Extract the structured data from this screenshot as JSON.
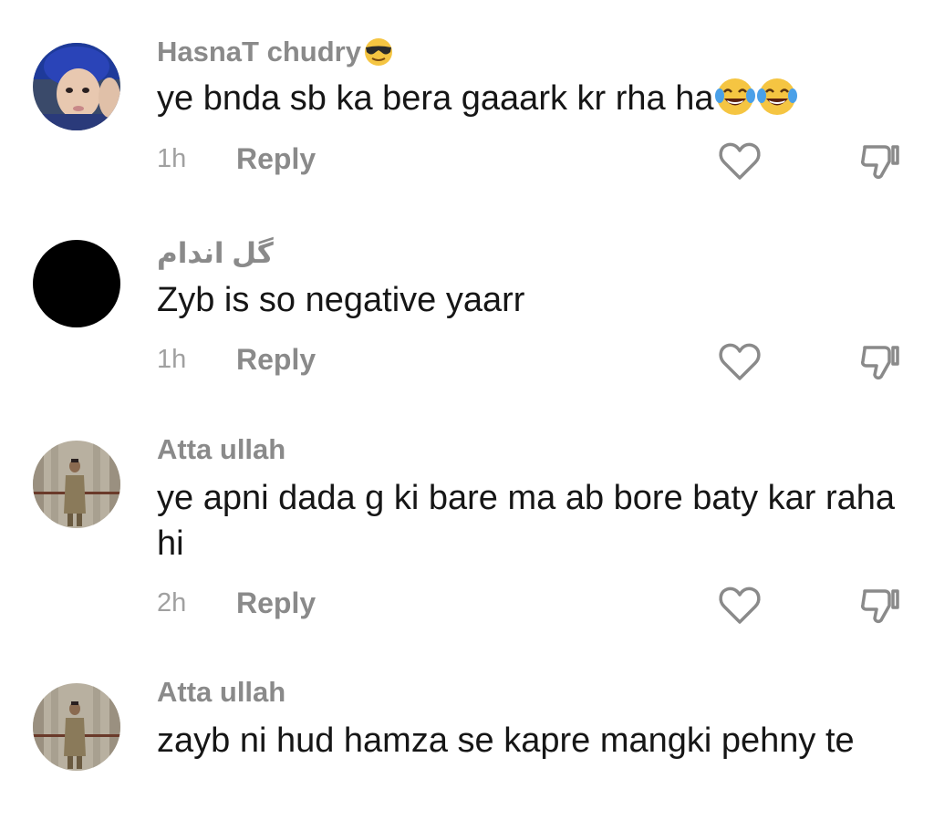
{
  "comments": [
    {
      "username": "HasnaT chudry",
      "username_emoji": "sunglasses-emoji",
      "text": "ye bnda sb ka bera gaaark kr rha ha",
      "text_emojis": [
        "laughing-tears-emoji",
        "laughing-tears-emoji"
      ],
      "time": "1h",
      "reply_label": "Reply",
      "avatar": "child-photo-avatar"
    },
    {
      "username": "گل اندام",
      "text": "Zyb is so negative yaarr",
      "time": "1h",
      "reply_label": "Reply",
      "avatar": "black-circle-avatar"
    },
    {
      "username": "Atta ullah",
      "text": "ye apni dada g ki bare ma ab bore baty kar raha hi",
      "time": "2h",
      "reply_label": "Reply",
      "avatar": "man-photo-avatar"
    },
    {
      "username": "Atta ullah",
      "text": "zayb ni hud hamza se kapre mangki pehny te",
      "avatar": "man-photo-avatar"
    }
  ],
  "colors": {
    "username": "#8a8a8a",
    "text": "#161616",
    "meta": "#a0a0a0",
    "icon": "#8a8a8a"
  },
  "icons": {
    "like": "heart-outline-icon",
    "dislike": "thumbs-down-outline-icon"
  }
}
